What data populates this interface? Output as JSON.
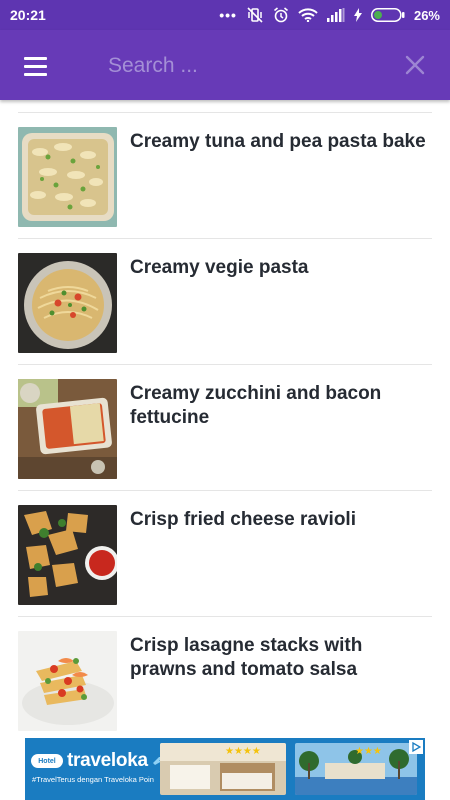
{
  "status_bar": {
    "time": "20:21",
    "battery_percent": "26%",
    "icons": [
      "more-dots-icon",
      "vibrate-off-icon",
      "alarm-icon",
      "wifi-icon",
      "signal-icon",
      "charging-icon",
      "battery-icon"
    ]
  },
  "app_bar": {
    "search_placeholder": "Search ...",
    "search_value": "",
    "menu_icon": "hamburger-menu-icon",
    "close_icon": "close-icon",
    "color": "#673ab7"
  },
  "recipes": [
    {
      "title": "Creamy tuna and pea pasta bake"
    },
    {
      "title": "Creamy vegie pasta"
    },
    {
      "title": "Creamy zucchini and bacon fettucine"
    },
    {
      "title": "Crisp fried cheese ravioli"
    },
    {
      "title": "Crisp lasagne stacks with prawns and tomato salsa"
    }
  ],
  "ad": {
    "badge": "Hotel",
    "brand": "traveloka",
    "tagline": "#TravelTerus dengan Traveloka Poin",
    "stars_1": "★★★★",
    "stars_2": "★★★"
  }
}
